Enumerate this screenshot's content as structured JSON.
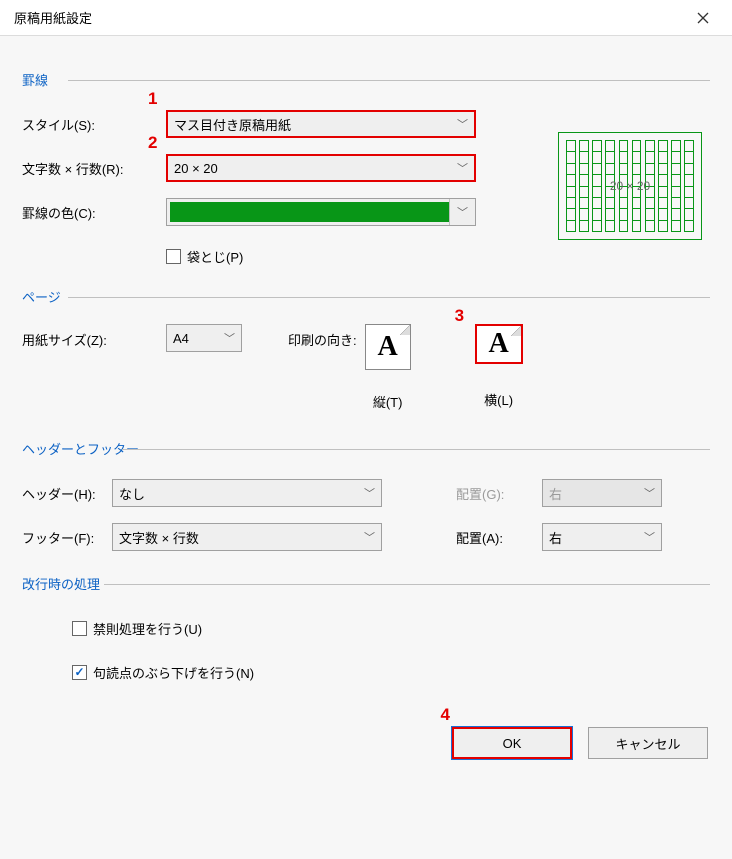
{
  "dialog": {
    "title": "原稿用紙設定"
  },
  "annotations": {
    "n1": "1",
    "n2": "2",
    "n3": "3",
    "n4": "4"
  },
  "ruled": {
    "group_label": "罫線",
    "style_label": "スタイル(S):",
    "style_value": "マス目付き原稿用紙",
    "grid_label": "文字数 × 行数(R):",
    "grid_value": "20 × 20",
    "color_label": "罫線の色(C):",
    "color_hex": "#089617",
    "bag_label": "袋とじ(P)",
    "bag_checked": false,
    "preview_text": "20 × 20"
  },
  "page": {
    "group_label": "ページ",
    "size_label": "用紙サイズ(Z):",
    "size_value": "A4",
    "orient_label": "印刷の向き:",
    "portrait_label": "縦(T)",
    "landscape_label": "横(L)"
  },
  "hf": {
    "group_label": "ヘッダーとフッター",
    "header_label": "ヘッダー(H):",
    "header_value": "なし",
    "header_align_label": "配置(G):",
    "header_align_value": "右",
    "footer_label": "フッター(F):",
    "footer_value": "文字数 × 行数",
    "footer_align_label": "配置(A):",
    "footer_align_value": "右"
  },
  "wrap": {
    "group_label": "改行時の処理",
    "kinsoku_label": "禁則処理を行う(U)",
    "kinsoku_checked": false,
    "burasage_label": "句読点のぶら下げを行う(N)",
    "burasage_checked": true
  },
  "buttons": {
    "ok": "OK",
    "cancel": "キャンセル"
  }
}
